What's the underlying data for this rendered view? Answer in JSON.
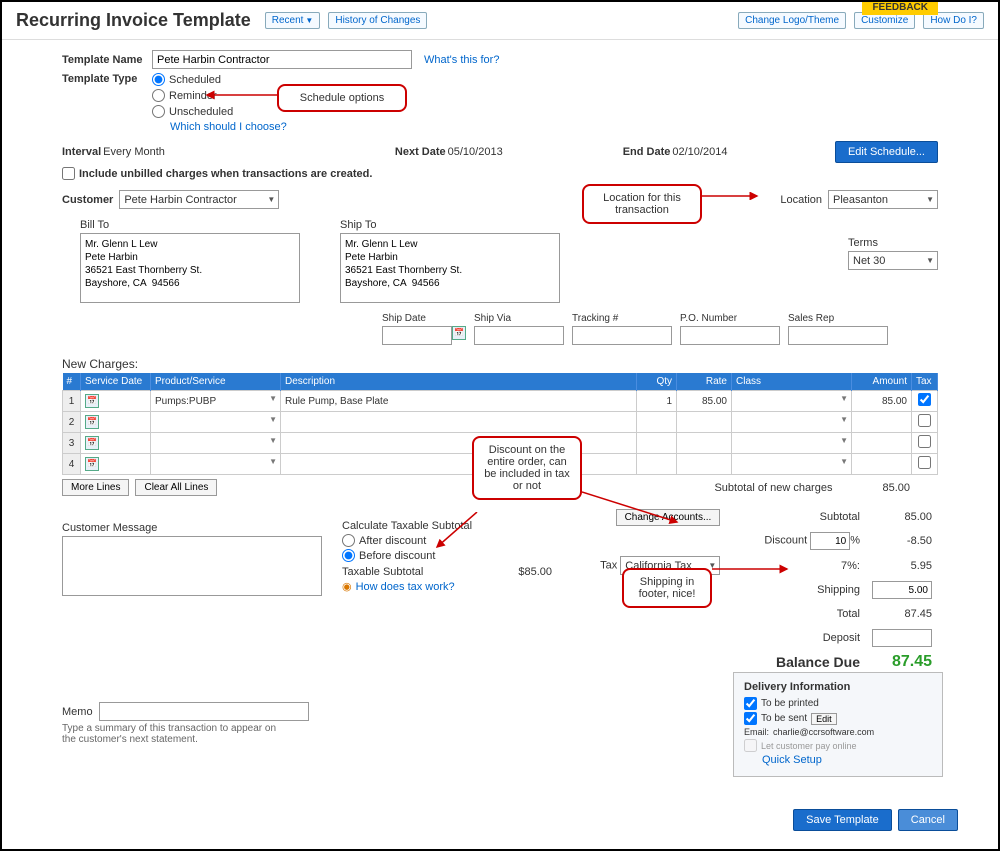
{
  "header": {
    "title": "Recurring Invoice Template",
    "recent": "Recent",
    "history": "History of Changes",
    "change_logo": "Change Logo/Theme",
    "customize": "Customize",
    "how_do_i": "How Do I?",
    "feedback": "FEEDBACK"
  },
  "template": {
    "name_label": "Template Name",
    "name_value": "Pete Harbin Contractor",
    "whats_this": "What's this for?",
    "type_label": "Template Type",
    "opt_scheduled": "Scheduled",
    "opt_reminder": "Reminder",
    "opt_unscheduled": "Unscheduled",
    "which_choose": "Which should I choose?"
  },
  "schedule": {
    "interval_label": "Interval",
    "interval_value": "Every Month",
    "next_label": "Next Date",
    "next_value": "05/10/2013",
    "end_label": "End Date",
    "end_value": "02/10/2014",
    "edit_btn": "Edit Schedule...",
    "include_unbilled": "Include unbilled charges when transactions are created."
  },
  "customer": {
    "label": "Customer",
    "value": "Pete Harbin Contractor",
    "location_label": "Location",
    "location_value": "Pleasanton"
  },
  "billto": {
    "label": "Bill To",
    "text": "Mr. Glenn L Lew\nPete Harbin\n36521 East Thornberry St.\nBayshore, CA  94566"
  },
  "shipto": {
    "label": "Ship To",
    "text": "Mr. Glenn L Lew\nPete Harbin\n36521 East Thornberry St.\nBayshore, CA  94566"
  },
  "terms": {
    "label": "Terms",
    "value": "Net 30"
  },
  "shipfields": {
    "shipdate": "Ship Date",
    "shipvia": "Ship Via",
    "tracking": "Tracking #",
    "po": "P.O. Number",
    "salesrep": "Sales Rep"
  },
  "grid": {
    "title": "New Charges:",
    "cols": {
      "num": "#",
      "date": "Service Date",
      "prod": "Product/Service",
      "desc": "Description",
      "qty": "Qty",
      "rate": "Rate",
      "class": "Class",
      "amount": "Amount",
      "tax": "Tax"
    },
    "rows": [
      {
        "n": "1",
        "prod": "Pumps:PUBP",
        "desc": "Rule Pump, Base Plate",
        "qty": "1",
        "rate": "85.00",
        "amount": "85.00",
        "taxed": true
      },
      {
        "n": "2",
        "prod": "",
        "desc": "",
        "qty": "",
        "rate": "",
        "amount": "",
        "taxed": false
      },
      {
        "n": "3",
        "prod": "",
        "desc": "",
        "qty": "",
        "rate": "",
        "amount": "",
        "taxed": false
      },
      {
        "n": "4",
        "prod": "",
        "desc": "",
        "qty": "",
        "rate": "",
        "amount": "",
        "taxed": false
      }
    ],
    "more_lines": "More Lines",
    "clear_all": "Clear All Lines",
    "sub_new_label": "Subtotal of new charges",
    "sub_new_value": "85.00"
  },
  "totals": {
    "change_accts": "Change Accounts...",
    "subtotal_label": "Subtotal",
    "subtotal": "85.00",
    "discount_label": "Discount",
    "discount_pct": "10",
    "pct_sym": "%",
    "discount_val": "-8.50",
    "tax_label": "Tax",
    "tax_name": "California Tax",
    "tax_rate": "7%:",
    "tax_val": "5.95",
    "shipping_label": "Shipping",
    "shipping_val": "5.00",
    "total_label": "Total",
    "total_val": "87.45",
    "deposit_label": "Deposit",
    "deposit_val": "",
    "balance_label": "Balance Due",
    "balance_val": "87.45"
  },
  "taxcalc": {
    "title": "Calculate Taxable Subtotal",
    "after": "After discount",
    "before": "Before discount",
    "ts_label": "Taxable Subtotal",
    "ts_value": "$85.00",
    "how": "How does tax work?"
  },
  "custmsg": {
    "label": "Customer Message"
  },
  "memo": {
    "label": "Memo",
    "hint": "Type a summary of this transaction to appear on the customer's next statement."
  },
  "delivery": {
    "title": "Delivery Information",
    "printed": "To be printed",
    "sent": "To be sent",
    "edit": "Edit",
    "email_label": "Email:",
    "email_value": "charlie@ccrsoftware.com",
    "pay_online": "Let customer pay online",
    "quick_setup": "Quick Setup"
  },
  "footer": {
    "save": "Save Template",
    "cancel": "Cancel"
  },
  "callouts": {
    "schedule": "Schedule options",
    "location": "Location for this transaction",
    "discount": "Discount on the entire order, can be included in tax or not",
    "shipping": "Shipping in footer, nice!"
  }
}
